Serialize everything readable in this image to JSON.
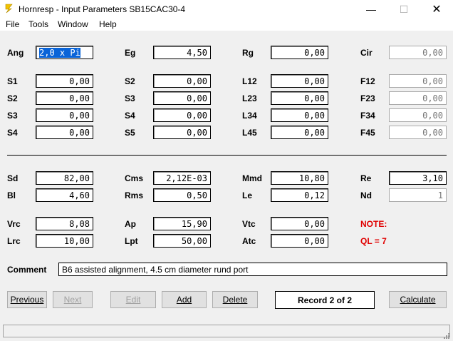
{
  "window": {
    "title": "Hornresp - Input Parameters   SB15CAC30-4"
  },
  "menu": [
    "File",
    "Tools",
    "Window",
    "Help"
  ],
  "rows": {
    "r1": [
      {
        "label": "Ang",
        "value": "2,0 x Pi"
      },
      {
        "label": "Eg",
        "value": "4,50"
      },
      {
        "label": "Rg",
        "value": "0,00"
      },
      {
        "label": "Cir",
        "value": "0,00"
      }
    ],
    "r2": [
      {
        "label": "S1",
        "value": "0,00"
      },
      {
        "label": "S2",
        "value": "0,00"
      },
      {
        "label": "L12",
        "value": "0,00"
      },
      {
        "label": "F12",
        "value": "0,00"
      }
    ],
    "r3": [
      {
        "label": "S2",
        "value": "0,00"
      },
      {
        "label": "S3",
        "value": "0,00"
      },
      {
        "label": "L23",
        "value": "0,00"
      },
      {
        "label": "F23",
        "value": "0,00"
      }
    ],
    "r4": [
      {
        "label": "S3",
        "value": "0,00"
      },
      {
        "label": "S4",
        "value": "0,00"
      },
      {
        "label": "L34",
        "value": "0,00"
      },
      {
        "label": "F34",
        "value": "0,00"
      }
    ],
    "r5": [
      {
        "label": "S4",
        "value": "0,00"
      },
      {
        "label": "S5",
        "value": "0,00"
      },
      {
        "label": "L45",
        "value": "0,00"
      },
      {
        "label": "F45",
        "value": "0,00"
      }
    ],
    "r6": [
      {
        "label": "Sd",
        "value": "82,00"
      },
      {
        "label": "Cms",
        "value": "2,12E-03"
      },
      {
        "label": "Mmd",
        "value": "10,80"
      },
      {
        "label": "Re",
        "value": "3,10"
      }
    ],
    "r7": [
      {
        "label": "Bl",
        "value": "4,60"
      },
      {
        "label": "Rms",
        "value": "0,50"
      },
      {
        "label": "Le",
        "value": "0,12"
      },
      {
        "label": "Nd",
        "value": "1"
      }
    ],
    "r8": [
      {
        "label": "Vrc",
        "value": "8,08"
      },
      {
        "label": "Ap",
        "value": "15,90"
      },
      {
        "label": "Vtc",
        "value": "0,00"
      }
    ],
    "r9": [
      {
        "label": "Lrc",
        "value": "10,00"
      },
      {
        "label": "Lpt",
        "value": "50,00"
      },
      {
        "label": "Atc",
        "value": "0,00"
      }
    ]
  },
  "note": {
    "line1": "NOTE:",
    "line2": "QL = 7"
  },
  "comment": {
    "label": "Comment",
    "value": "B6 assisted alignment, 4.5 cm diameter rund port"
  },
  "buttons": {
    "previous": "Previous",
    "next": "Next",
    "edit": "Edit",
    "add": "Add",
    "delete": "Delete",
    "calculate": "Calculate"
  },
  "record": "Record 2 of 2",
  "colors": {
    "note": "#e00000",
    "selection": "#0a64d8"
  }
}
